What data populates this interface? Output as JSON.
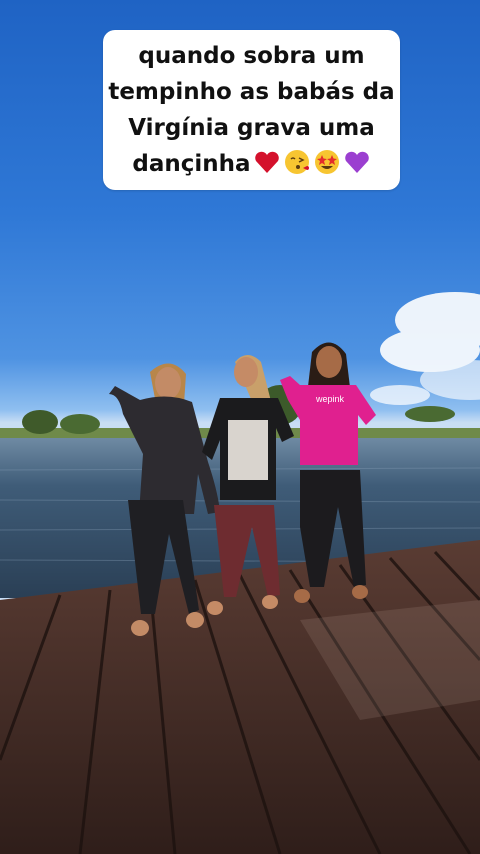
{
  "caption": {
    "line1": "quando sobra um",
    "line2": "tempinho as babás da",
    "line3": "Virgínia grava uma",
    "line4": "dançinha",
    "emojis": [
      "red-heart",
      "face-blowing-kiss",
      "star-struck",
      "purple-heart"
    ]
  },
  "shirt_text": "wepink",
  "colors": {
    "sky": "#2f78d6",
    "water": "#2e4a63",
    "dock": "#4a2f28",
    "pink_shirt": "#e0208f"
  }
}
